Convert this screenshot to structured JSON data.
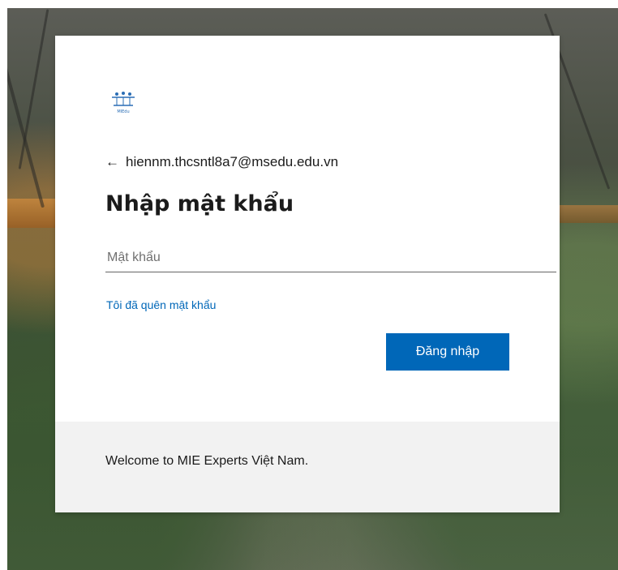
{
  "login": {
    "account_email": "hiennm.thcsntl8a7@msedu.edu.vn",
    "title": "Nhập mật khẩu",
    "password_placeholder": "Mật khẩu",
    "forgot_link": "Tôi đã quên mật khẩu",
    "signin_button": "Đăng nhập",
    "back_icon": "arrow-left-icon",
    "logo_icon": "organization-logo-icon",
    "logo_caption": "MIEdu"
  },
  "footer": {
    "welcome_text": "Welcome to MIE Experts Việt Nam."
  },
  "colors": {
    "accent": "#0067b8",
    "footer_bg": "#f2f2f2"
  }
}
